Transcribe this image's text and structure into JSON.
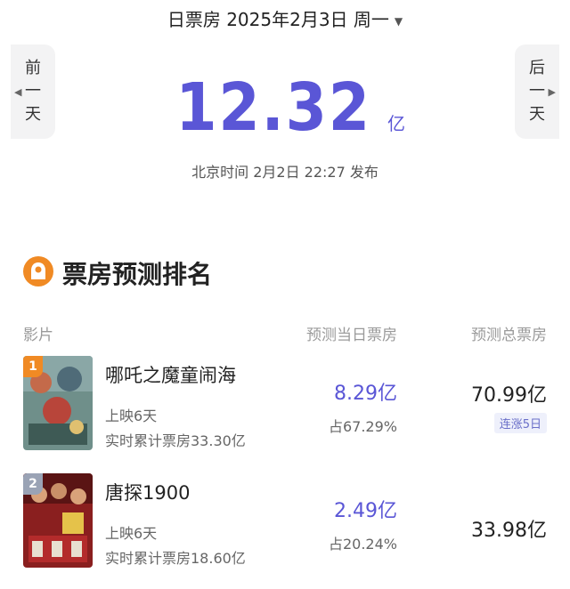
{
  "header": {
    "title": "日票房 2025年2月3日 周一",
    "prev_label": [
      "前",
      "一",
      "天"
    ],
    "next_label": [
      "后",
      "一",
      "天"
    ],
    "total_value": "12.32",
    "total_unit": "亿",
    "publish_time": "北京时间 2月2日 22:27 发布"
  },
  "section": {
    "title": "票房预测排名",
    "col_film": "影片",
    "col_day": "预测当日票房",
    "col_total": "预测总票房"
  },
  "films": [
    {
      "rank": "1",
      "title": "哪吒之魔童闹海",
      "days": "上映6天",
      "cumulative": "实时累计票房33.30亿",
      "day_box": "8.29亿",
      "share": "占67.29%",
      "total": "70.99亿",
      "badge": "连涨5日"
    },
    {
      "rank": "2",
      "title": "唐探1900",
      "days": "上映6天",
      "cumulative": "实时累计票房18.60亿",
      "day_box": "2.49亿",
      "share": "占20.24%",
      "total": "33.98亿"
    }
  ],
  "colors": {
    "accent": "#5a56d6",
    "section_icon": "#f08a24",
    "rank1": "#f08a24",
    "rank2": "#9aa3b5"
  }
}
